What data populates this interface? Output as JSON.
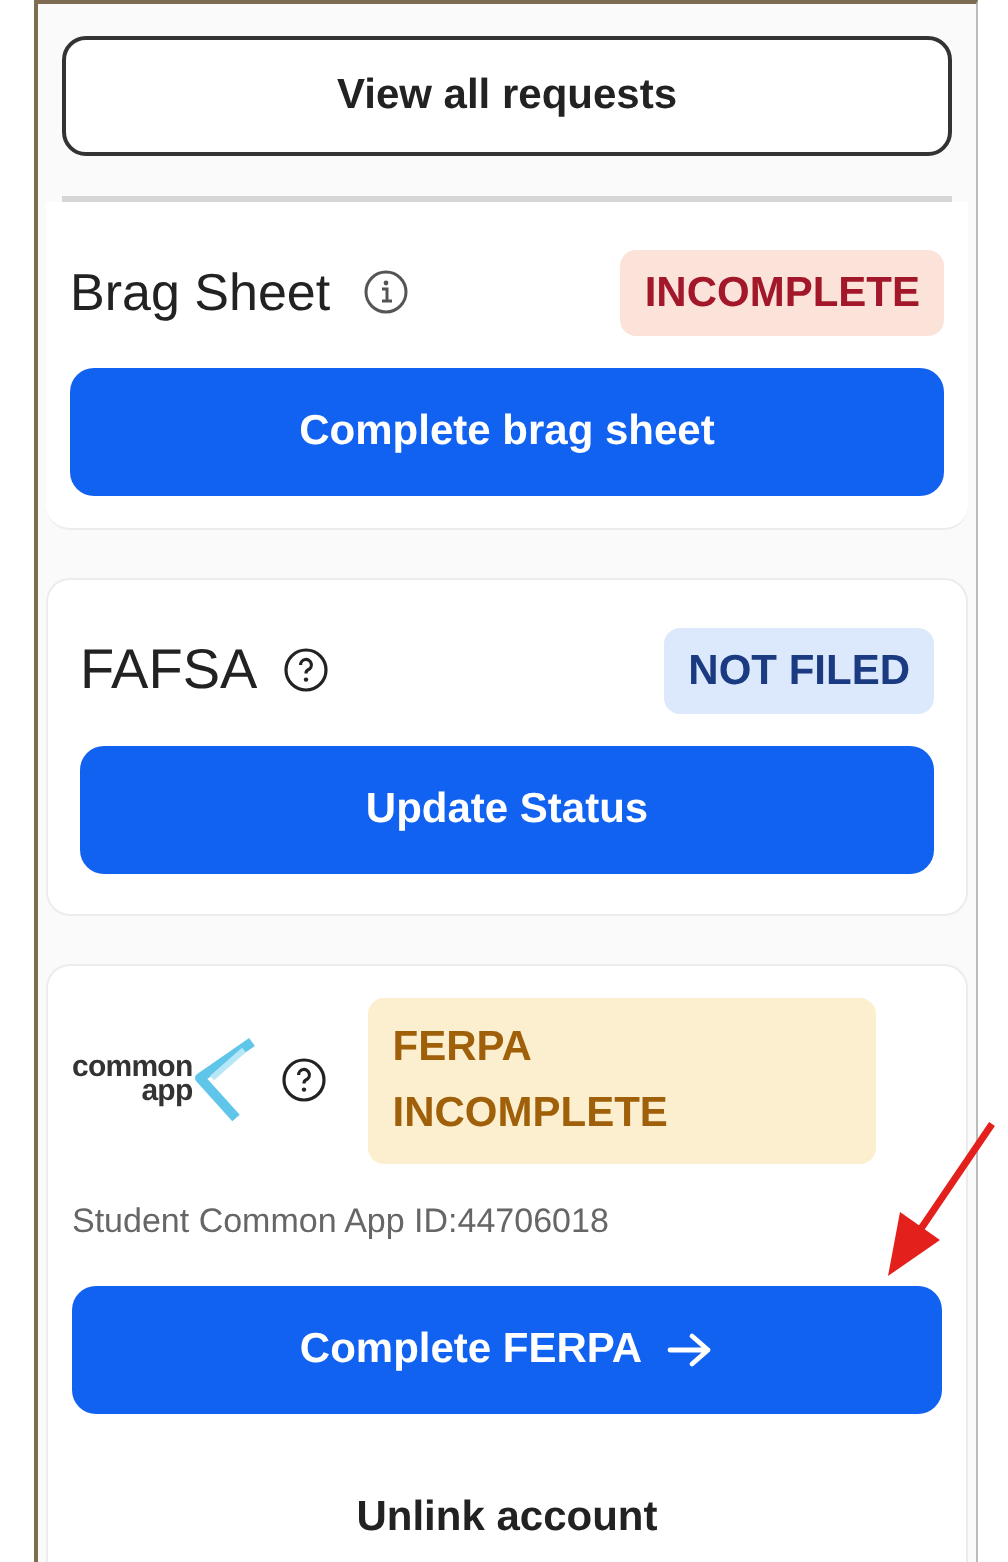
{
  "top_button": {
    "label": "View all requests"
  },
  "cards": [
    {
      "kind": "brag",
      "title": "Brag Sheet",
      "status": {
        "label": "INCOMPLETE"
      },
      "action": {
        "label": "Complete brag sheet",
        "arrow": false
      }
    },
    {
      "kind": "fafsa",
      "title": "FAFSA",
      "status": {
        "label": "NOT FILED"
      },
      "action": {
        "label": "Update Status",
        "arrow": false
      }
    },
    {
      "kind": "commonapp",
      "logo_text": [
        "common",
        "app"
      ],
      "status": {
        "label": "FERPA INCOMPLETE"
      },
      "detail": "Student Common App ID:44706018",
      "action": {
        "label": "Complete FERPA",
        "arrow": true
      },
      "secondary_action": {
        "label": "Unlink account"
      }
    }
  ],
  "annotation": {
    "kind": "arrow",
    "color": "#e3201b"
  }
}
